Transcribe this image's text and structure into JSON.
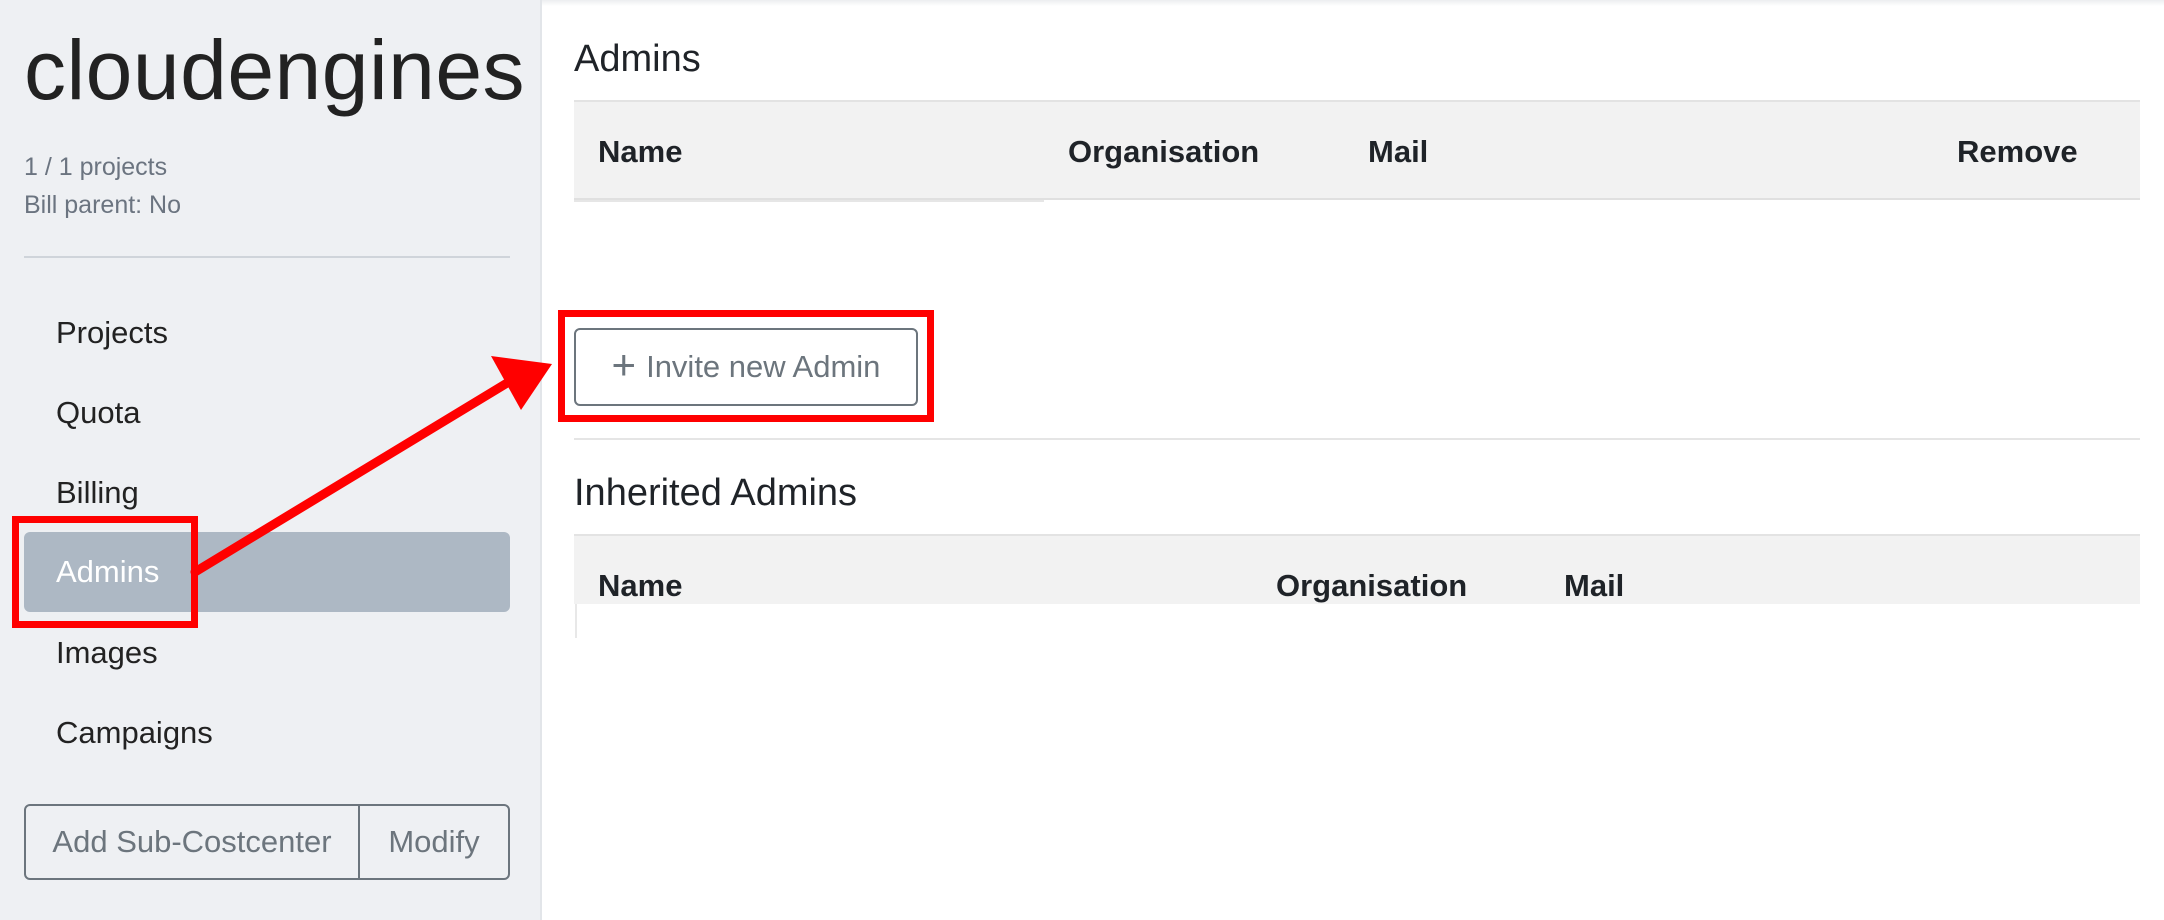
{
  "sidebar": {
    "org_name": "cloudengines",
    "projects_count": "1 / 1 projects",
    "bill_parent": "Bill parent: No",
    "nav": [
      {
        "label": "Projects"
      },
      {
        "label": "Quota"
      },
      {
        "label": "Billing"
      },
      {
        "label": "Admins",
        "active": true
      },
      {
        "label": "Images"
      },
      {
        "label": "Campaigns"
      }
    ],
    "add_sub_costcenter_label": "Add Sub-Costcenter",
    "modify_label": "Modify"
  },
  "admins": {
    "title": "Admins",
    "columns": [
      "Name",
      "Organisation",
      "Mail",
      "Remove"
    ],
    "rows": [],
    "invite_label": "Invite new Admin"
  },
  "inherited_admins": {
    "title": "Inherited Admins",
    "columns": [
      "Name",
      "Organisation",
      "Mail"
    ],
    "rows": []
  },
  "colors": {
    "highlight": "#ff0000",
    "active_nav": "#adb8c4",
    "secondary": "#6c757d"
  },
  "icons": {
    "invite": "plus-icon",
    "annotation_arrow": "arrow-icon"
  }
}
